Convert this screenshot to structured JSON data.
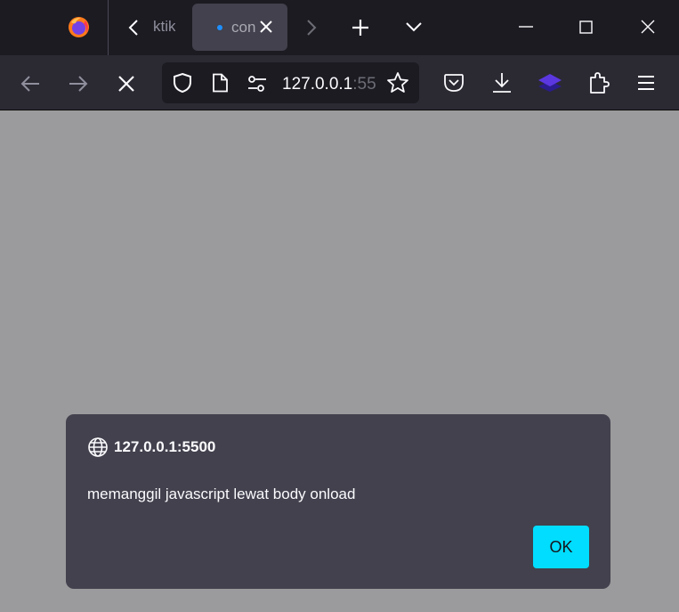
{
  "tabs": {
    "tab_partial_label": "ktik",
    "active_tab_label": "con"
  },
  "urlbar": {
    "host": "127.0.0.1",
    "port_fragment": ":55"
  },
  "dialog": {
    "origin": "127.0.0.1:5500",
    "message": "memanggil javascript lewat body onload",
    "ok_label": "OK"
  },
  "icons": [
    "firefox-logo-icon",
    "tab-scroll-left-icon",
    "tab-close-icon",
    "tab-scroll-right-icon",
    "new-tab-icon",
    "tab-list-icon",
    "minimize-icon",
    "maximize-icon",
    "close-window-icon",
    "back-icon",
    "forward-icon",
    "stop-icon",
    "shield-icon",
    "page-icon",
    "permissions-icon",
    "bookmark-star-icon",
    "pocket-icon",
    "download-icon",
    "extension-layers-icon",
    "extensions-icon",
    "menu-icon",
    "globe-icon"
  ],
  "colors": {
    "tabbar_bg": "#1c1b22",
    "toolbar_bg": "#2b2a33",
    "active_tab_bg": "#42414d",
    "dialog_bg": "#42414d",
    "page_overlay": "#9b9b9d",
    "accent_button": "#00ddff",
    "loading_dot": "#1f8fff"
  }
}
